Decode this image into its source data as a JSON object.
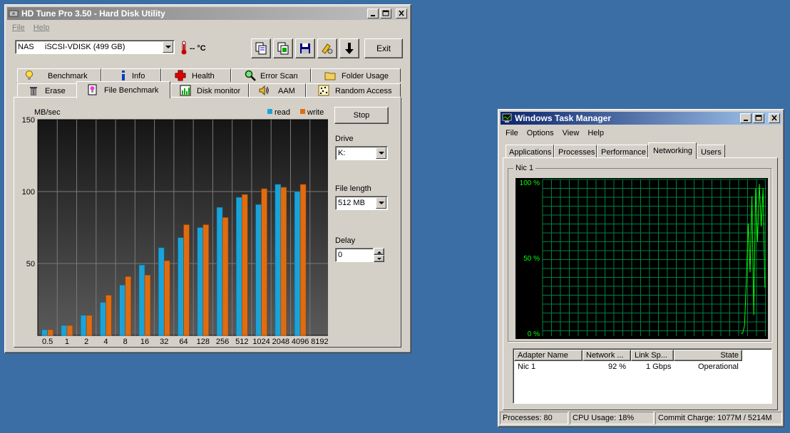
{
  "hdtune": {
    "title": "HD Tune Pro 3.50 - Hard Disk Utility",
    "menu": [
      "File",
      "Help"
    ],
    "drive_select": "NAS     iSCSI-VDISK (499 GB)",
    "temperature": "-- °C",
    "exit_label": "Exit",
    "tabs_row1": [
      "Benchmark",
      "Info",
      "Health",
      "Error Scan",
      "Folder Usage"
    ],
    "tabs_row2": [
      "Erase",
      "File Benchmark",
      "Disk monitor",
      "AAM",
      "Random Access"
    ],
    "active_tab": "File Benchmark",
    "stop_label": "Stop",
    "drive_label": "Drive",
    "drive_value": "K:",
    "file_length_label": "File length",
    "file_length_value": "512 MB",
    "delay_label": "Delay",
    "delay_value": "0"
  },
  "chart_data": {
    "type": "bar",
    "ylabel": "MB/sec",
    "ylim": [
      0,
      150
    ],
    "yticks": [
      50,
      100,
      150
    ],
    "categories": [
      "0.5",
      "1",
      "2",
      "4",
      "8",
      "16",
      "32",
      "64",
      "128",
      "256",
      "512",
      "1024",
      "2048",
      "4096",
      "8192"
    ],
    "series": [
      {
        "name": "read",
        "color": "#1aa3d9",
        "values": [
          4,
          7,
          14,
          23,
          35,
          49,
          61,
          68,
          75,
          89,
          96,
          91,
          105,
          100,
          null
        ]
      },
      {
        "name": "write",
        "color": "#e06c10",
        "values": [
          4,
          7,
          14,
          28,
          41,
          42,
          52,
          77,
          77,
          82,
          98,
          102,
          103,
          105,
          null
        ]
      }
    ],
    "legend_position": "top-right",
    "grid": true
  },
  "taskmgr": {
    "title": "Windows Task Manager",
    "menu": [
      "File",
      "Options",
      "View",
      "Help"
    ],
    "tabs": [
      "Applications",
      "Processes",
      "Performance",
      "Networking",
      "Users"
    ],
    "active_tab": "Networking",
    "group_label": "Nic 1",
    "graph_labels": [
      "100 %",
      "50 %",
      "0 %"
    ],
    "columns": [
      "Adapter Name",
      "Network ...",
      "Link Sp...",
      "State"
    ],
    "row": {
      "adapter": "Nic 1",
      "utilization": "92 %",
      "link_speed": "1 Gbps",
      "state": "Operational"
    },
    "status": {
      "processes": "Processes: 80",
      "cpu": "CPU Usage: 18%",
      "commit": "Commit Charge: 1077M / 5214M"
    },
    "network_trace": [
      0,
      0,
      5,
      35,
      72,
      40,
      90,
      12,
      95,
      60,
      98,
      70,
      95,
      30
    ]
  }
}
